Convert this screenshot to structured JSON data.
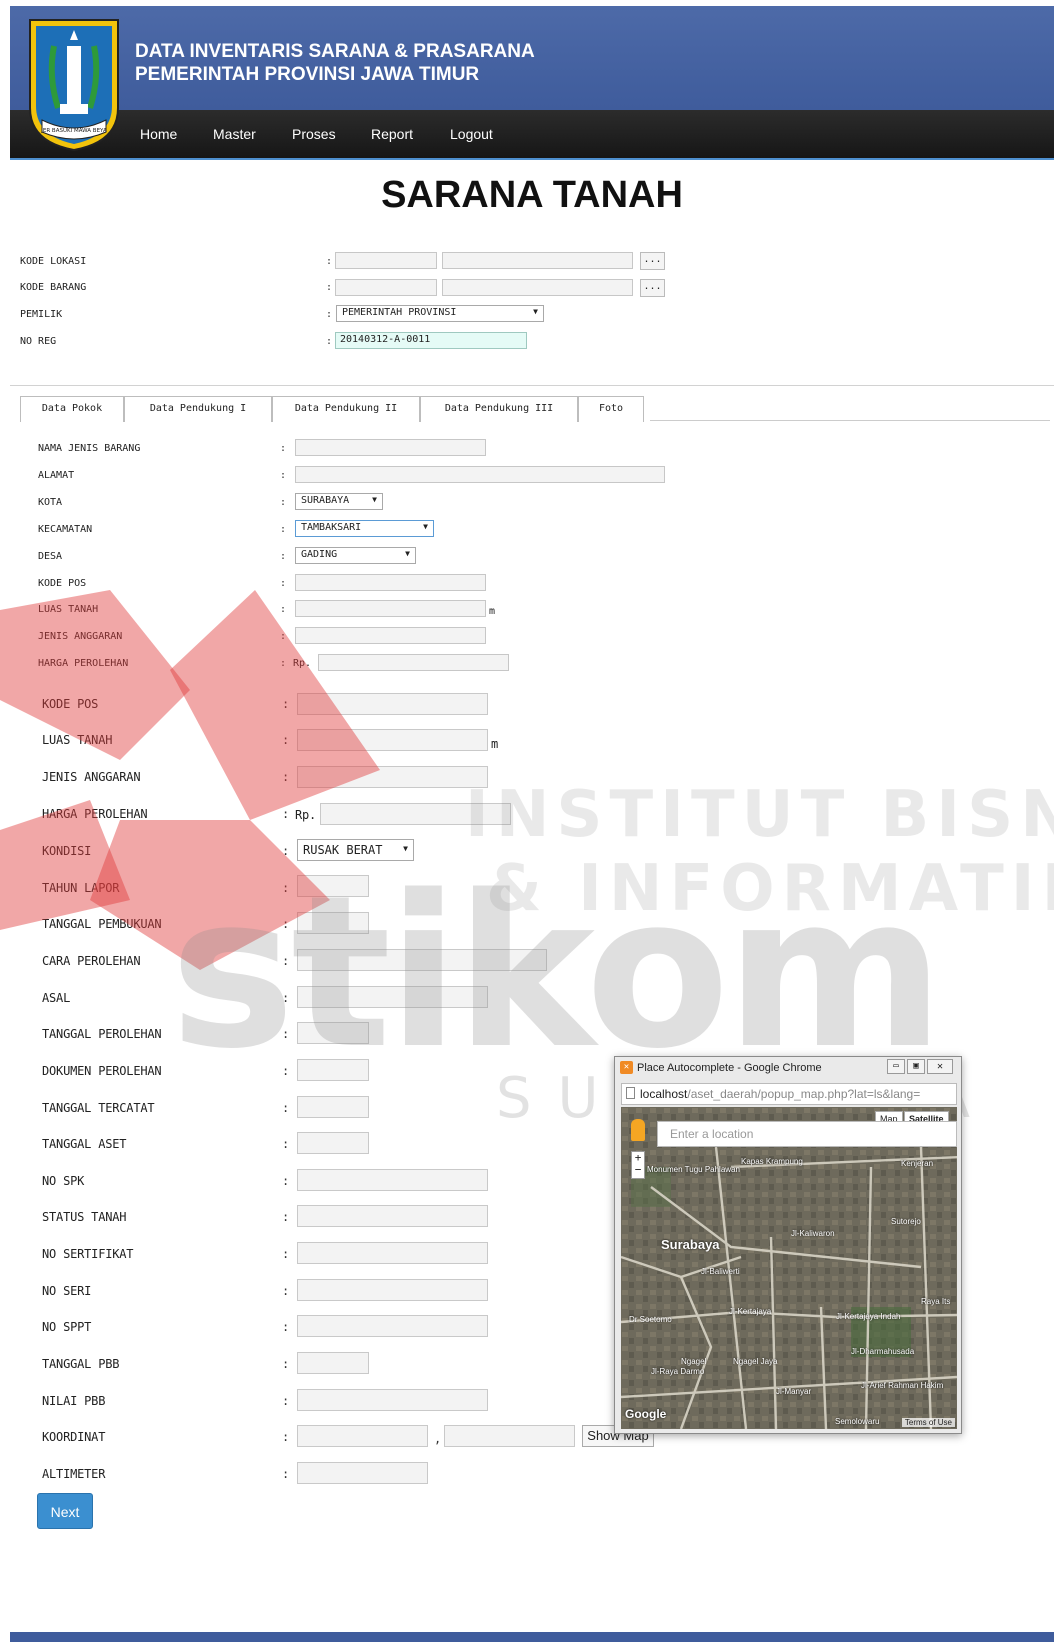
{
  "header": {
    "title_line1": "DATA INVENTARIS SARANA & PRASARANA",
    "title_line2": "PEMERINTAH PROVINSI JAWA TIMUR",
    "logo_text": "JER BASUKI MAWA BEYA"
  },
  "nav": {
    "items": [
      "Home",
      "Master",
      "Proses",
      "Report",
      "Logout"
    ]
  },
  "page": {
    "title": "SARANA TANAH"
  },
  "top_form": {
    "kode_lokasi_label": "KODE LOKASI",
    "kode_barang_label": "KODE BARANG",
    "pemilik_label": "PEMILIK",
    "pemilik_value": "PEMERINTAH PROVINSI",
    "noreg_label": "NO REG",
    "noreg_value": "20140312-A-0011",
    "lookup_button": "...",
    "colon": ":"
  },
  "tabs": [
    "Data Pokok",
    "Data Pendukung I",
    "Data Pendukung II",
    "Data Pendukung III",
    "Foto"
  ],
  "form_small": {
    "nama_jenis_barang": "NAMA JENIS BARANG",
    "alamat": "ALAMAT",
    "kota": "KOTA",
    "kota_value": "SURABAYA",
    "kecamatan": "KECAMATAN",
    "kecamatan_value": "TAMBAKSARI",
    "desa": "DESA",
    "desa_value": "GADING",
    "kode_pos": "KODE POS",
    "luas_tanah": "LUAS TANAH",
    "unit_m": "m",
    "jenis_anggaran": "JENIS ANGGARAN",
    "harga_perolehan": "HARGA PEROLEHAN",
    "rp": "Rp."
  },
  "form_large": {
    "kode_pos": "KODE POS",
    "luas_tanah": "LUAS TANAH",
    "unit_m": "m",
    "jenis_anggaran": "JENIS ANGGARAN",
    "harga_perolehan": "HARGA PEROLEHAN",
    "rp": "Rp.",
    "kondisi": "KONDISI",
    "kondisi_value": "RUSAK BERAT",
    "tahun_lapor": "TAHUN LAPOR",
    "tanggal_pembukuan": "TANGGAL PEMBUKUAN",
    "cara_perolehan": "CARA PEROLEHAN",
    "asal": "ASAL",
    "tanggal_perolehan": "TANGGAL PEROLEHAN",
    "dokumen_perolehan": "DOKUMEN PEROLEHAN",
    "tanggal_tercatat": "TANGGAL TERCATAT",
    "tanggal_aset": "TANGGAL ASET",
    "no_spk": "NO SPK",
    "status_tanah": "STATUS TANAH",
    "no_sertifikat": "NO SERTIFIKAT",
    "no_seri": "NO SERI",
    "no_sppt": "NO SPPT",
    "tanggal_pbb": "TANGGAL PBB",
    "nilai_pbb": "NILAI PBB",
    "koordinat": "KOORDINAT",
    "koordinat_sep": ",",
    "show_map_button": "Show Map",
    "altimeter": "ALTIMETER",
    "next_button": "Next"
  },
  "watermark": {
    "line1": "INSTITUT BISNIS",
    "line2": "& INFORMATIKA",
    "brand": "stikom",
    "city": "SURABAYA"
  },
  "popup": {
    "title": "Place Autocomplete - Google Chrome",
    "url_host": "localhost",
    "url_path": "/aset_daerah/popup_map.php?lat=ls&lang=",
    "map_button": "Map",
    "satellite_button": "Satellite",
    "search_placeholder": "Enter a location",
    "city_label": "Surabaya",
    "google": "Google",
    "terms": "Terms of Use",
    "roads": [
      "Monumen Tugu Pahlawan",
      "Kapas Krampung",
      "Kenjeran",
      "Jl-Kaliwaron",
      "Sutorejo",
      "Jl-Kertajaya",
      "Jl-Kertajaya Indah",
      "Raya Its",
      "Dr Soetomo",
      "Jl-Arief Rahman Hakim",
      "Semolowaru",
      "Ngagel",
      "Ngagel Jaya",
      "Jl-Manyar",
      "Jl-Dharmahusada",
      "Jl-Raya Darmo",
      "Jl-Baliwerti"
    ]
  },
  "colors": {
    "header_blue": "#4d6aa8",
    "nav_dark": "#1f1f1f",
    "accent_blue": "#3b8fd0",
    "noreg_bg": "#e5fbf6",
    "watermark_red": "#d23b3b"
  }
}
